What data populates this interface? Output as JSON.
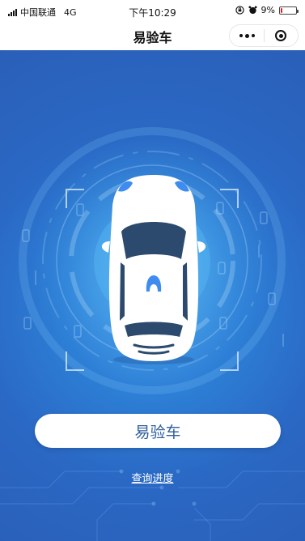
{
  "status_bar": {
    "carrier": "中国联通",
    "network": "4G",
    "time": "下午10:29",
    "battery_text": "9%",
    "battery_level": 0.09,
    "battery_color": "#e02020"
  },
  "title_bar": {
    "title": "易验车",
    "more_icon": "more-dots-icon",
    "close_icon": "target-circle-icon"
  },
  "hero": {
    "background_color": "#2a68c4",
    "illustration": "car-top-view-icon"
  },
  "main_button": {
    "label": "易验车",
    "text_color": "#2f5f9e"
  },
  "progress_link": {
    "label": "查询进度"
  }
}
